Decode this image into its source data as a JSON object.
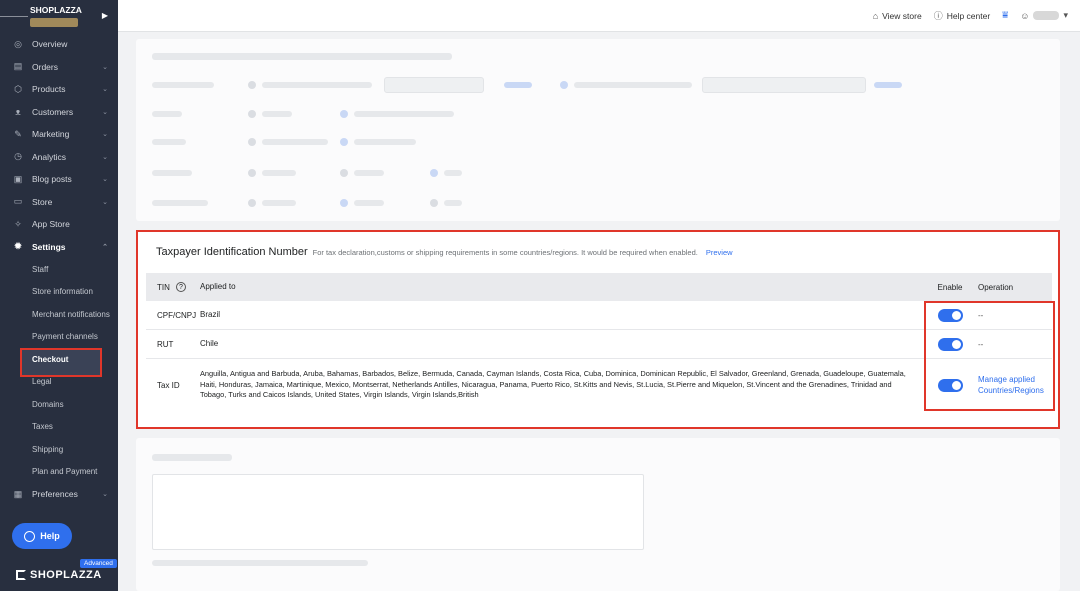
{
  "brand": {
    "store_name": "SHOPLAZZA"
  },
  "sidebar": {
    "items": [
      {
        "name": "overview",
        "label": "Overview",
        "icon": "◎",
        "chevron": ""
      },
      {
        "name": "orders",
        "label": "Orders",
        "icon": "▤",
        "chevron": "⌄"
      },
      {
        "name": "products",
        "label": "Products",
        "icon": "⬡",
        "chevron": "⌄"
      },
      {
        "name": "customers",
        "label": "Customers",
        "icon": "ᴥ",
        "chevron": "⌄"
      },
      {
        "name": "marketing",
        "label": "Marketing",
        "icon": "✎",
        "chevron": "⌄"
      },
      {
        "name": "analytics",
        "label": "Analytics",
        "icon": "◷",
        "chevron": "⌄"
      },
      {
        "name": "blog-posts",
        "label": "Blog posts",
        "icon": "▣",
        "chevron": "⌄"
      },
      {
        "name": "store",
        "label": "Store",
        "icon": "▭",
        "chevron": "⌄"
      },
      {
        "name": "app-store",
        "label": "App Store",
        "icon": "✧",
        "chevron": ""
      },
      {
        "name": "settings",
        "label": "Settings",
        "icon": "✹",
        "chevron": "⌃"
      }
    ],
    "settings_sub": [
      "Staff",
      "Store information",
      "Merchant notifications",
      "Payment channels",
      "Checkout",
      "Legal",
      "Domains",
      "Taxes",
      "Shipping",
      "Plan and Payment"
    ],
    "preferences": {
      "label": "Preferences",
      "icon": "▦",
      "chevron": "⌄"
    },
    "help_label": "Help",
    "plan_badge": "Advanced",
    "logo_text": "SHOPLAZZA"
  },
  "topbar": {
    "view_store": "View store",
    "help_center": "Help center",
    "view_store_icon": "home-icon",
    "help_icon": "question-circle-icon"
  },
  "tin": {
    "title": "Taxpayer Identification Number",
    "description": "For tax declaration,customs or shipping requirements in some countries/regions. It would be required when enabled.",
    "preview": "Preview",
    "headers": {
      "tin": "TIN",
      "applied_to": "Applied to",
      "enable": "Enable",
      "operation": "Operation"
    },
    "rows": [
      {
        "tin": "CPF/CNPJ",
        "applied_to": "Brazil",
        "enabled": true,
        "operation": "--"
      },
      {
        "tin": "RUT",
        "applied_to": "Chile",
        "enabled": true,
        "operation": "--"
      },
      {
        "tin": "Tax ID",
        "applied_to": "Anguilla, Antigua and Barbuda, Aruba, Bahamas, Barbados, Belize, Bermuda, Canada, Cayman Islands, Costa Rica, Cuba, Dominica, Dominican Republic, El Salvador, Greenland, Grenada, Guadeloupe, Guatemala, Haiti, Honduras, Jamaica, Martinique, Mexico, Montserrat, Netherlands Antilles, Nicaragua, Panama, Puerto Rico, St.Kitts and Nevis, St.Lucia, St.Pierre and Miquelon, St.Vincent and the Grenadines, Trinidad and Tobago, Turks and Caicos Islands, United States, Virgin Islands, Virgin Islands,British",
        "enabled": true,
        "operation": "Manage applied Countries/Regions"
      }
    ]
  },
  "colors": {
    "accent": "#2f6fed",
    "highlight": "#e0362a",
    "sidebar_bg": "#282f3f"
  }
}
